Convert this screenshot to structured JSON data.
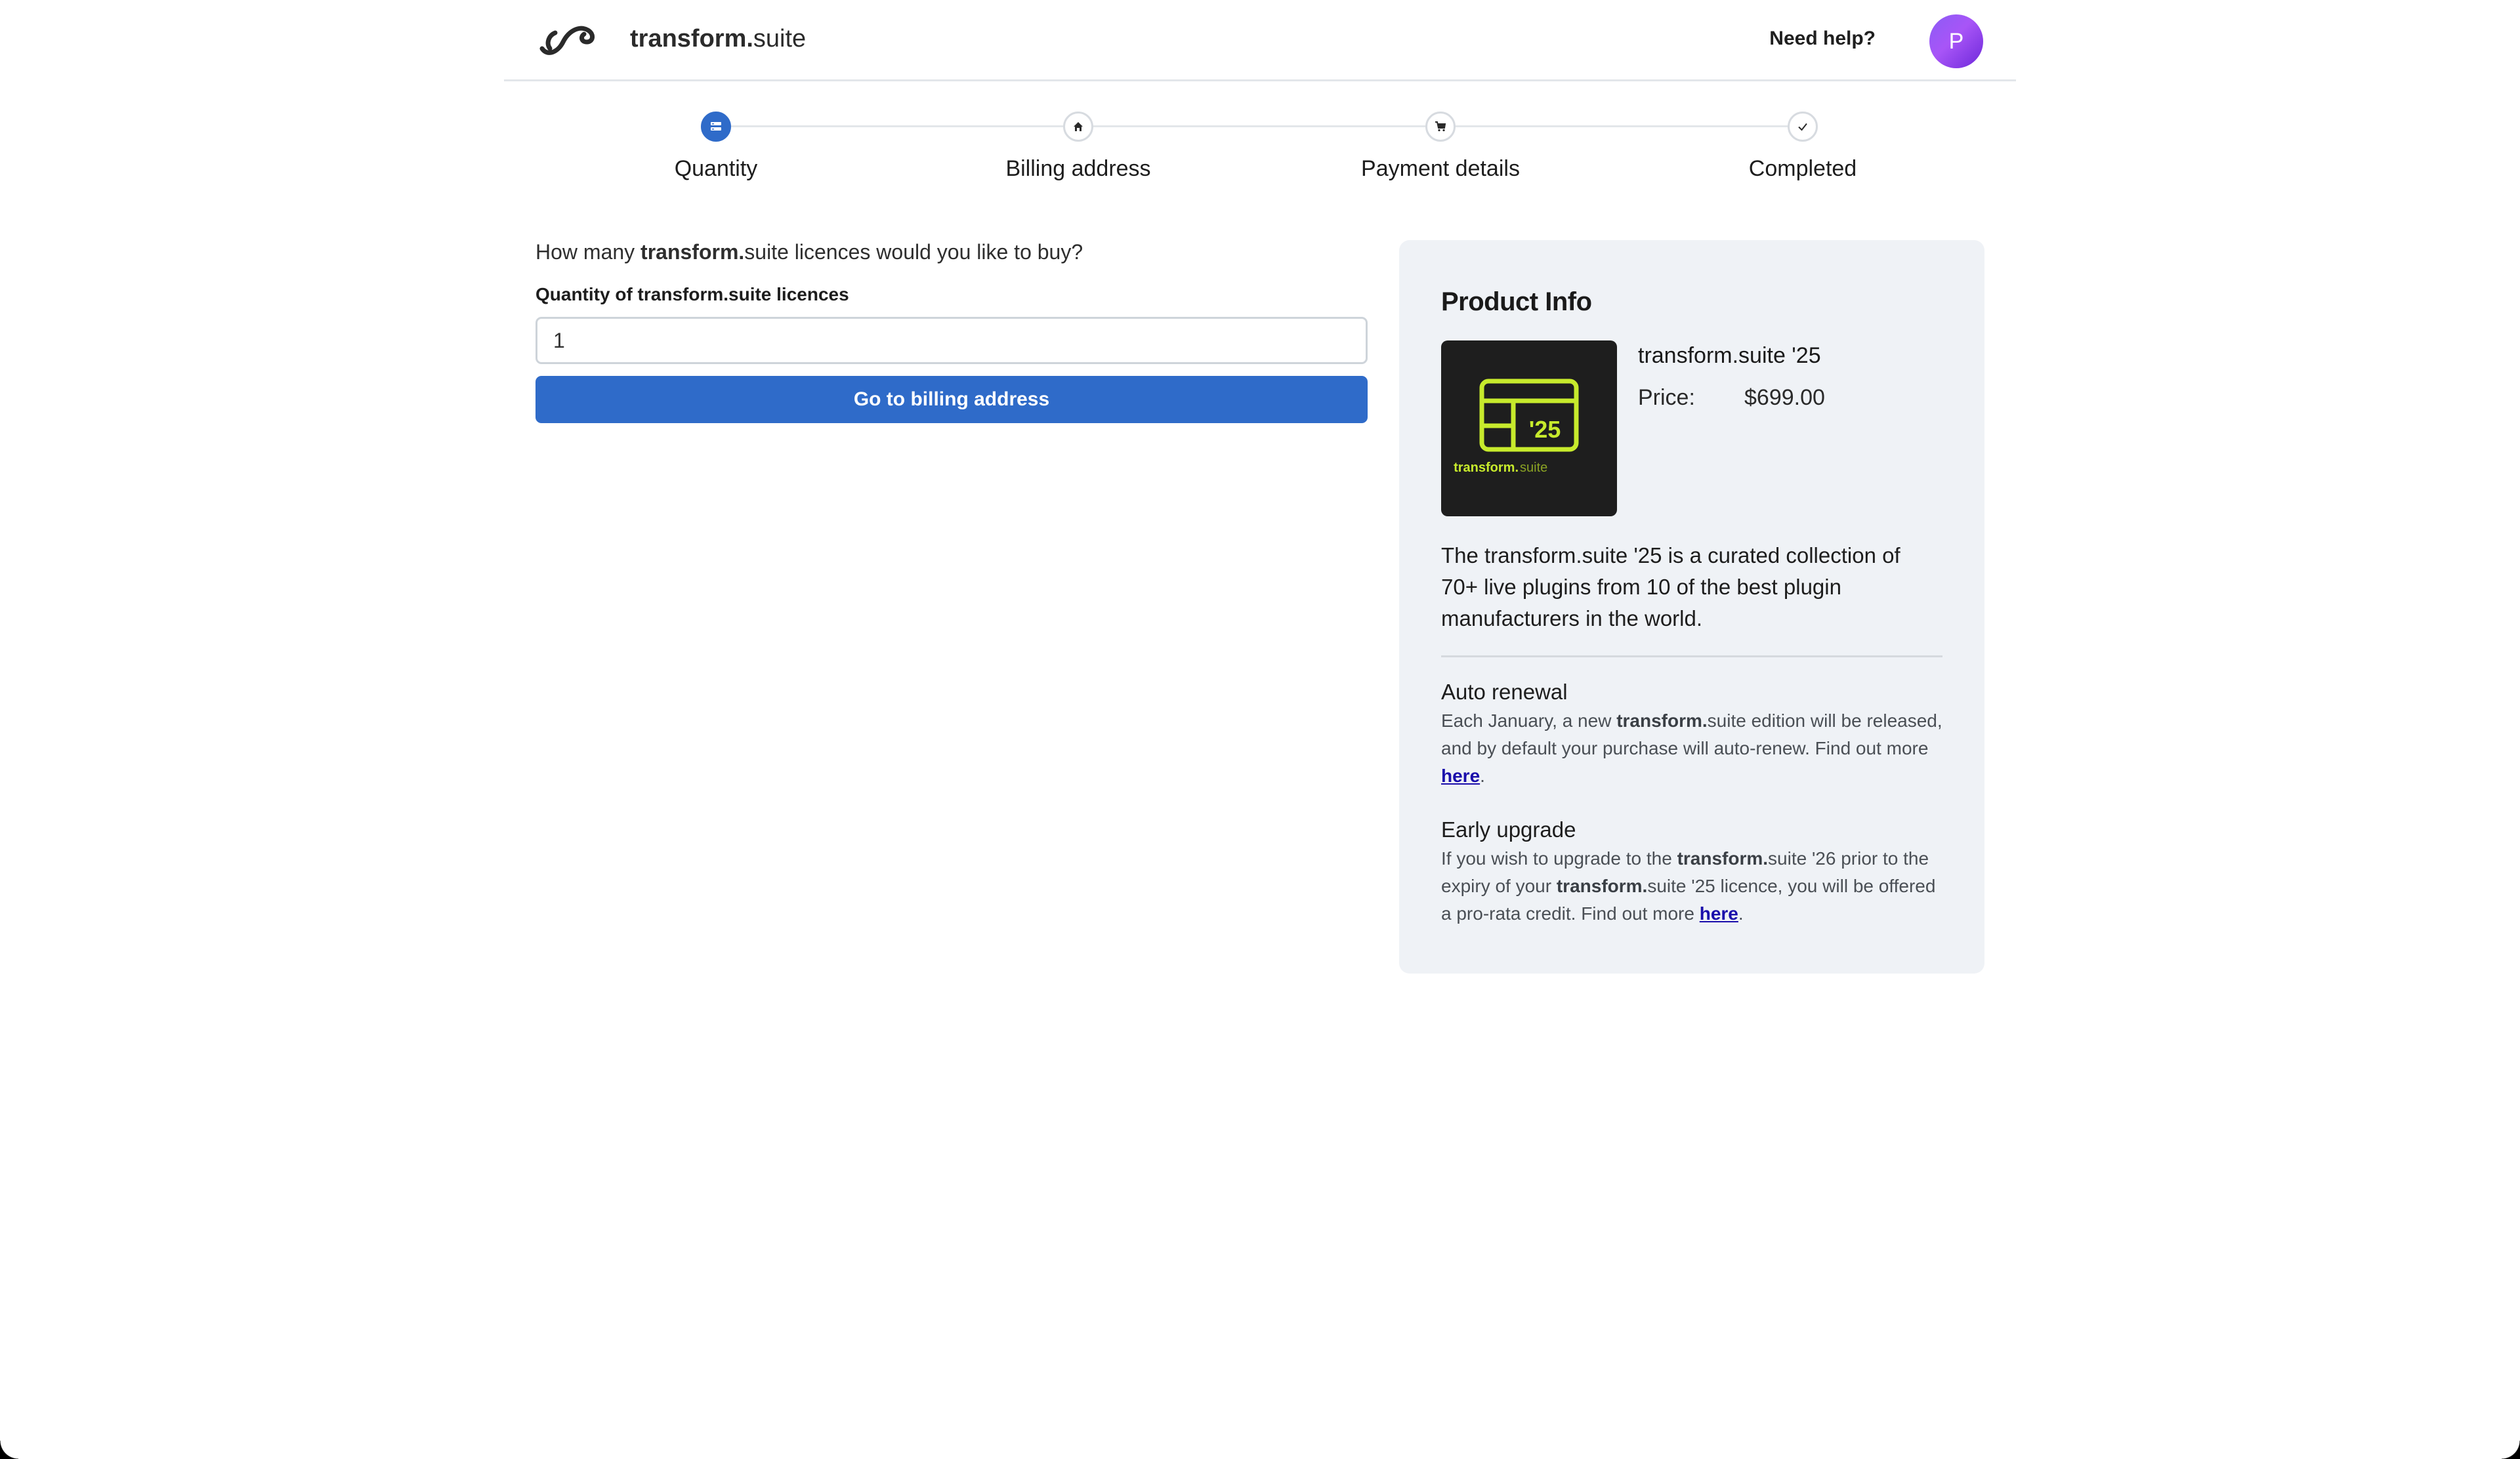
{
  "header": {
    "brand_bold": "transform.",
    "brand_rest": "suite",
    "help_label": "Need help?",
    "avatar_initial": "P"
  },
  "stepper": {
    "steps": [
      {
        "label": "Quantity",
        "icon": "list-icon",
        "state": "active"
      },
      {
        "label": "Billing address",
        "icon": "home-icon",
        "state": "pending"
      },
      {
        "label": "Payment details",
        "icon": "cart-icon",
        "state": "pending"
      },
      {
        "label": "Completed",
        "icon": "check-icon",
        "state": "pending"
      }
    ]
  },
  "form": {
    "question_pre": "How many ",
    "question_bold": "transform.",
    "question_post": "suite licences would you like to buy?",
    "field_label_pre": "Quantity of ",
    "field_label_bold": "transform.",
    "field_label_post": "suite licences",
    "quantity_value": "1",
    "submit_label": "Go to billing address"
  },
  "product": {
    "card_title": "Product Info",
    "name": "transform.suite '25",
    "price_label": "Price:",
    "price_value": "$699.00",
    "image_year": "'25",
    "image_brand_bold": "transform.",
    "image_brand_rest": "suite",
    "description": "The transform.suite '25 is a curated collection of 70+ live plugins from 10 of the best plugin manufacturers in the world.",
    "auto_renewal": {
      "title": "Auto renewal",
      "text_1": "Each January, a new ",
      "text_bold": "transform.",
      "text_2": "suite edition will be released, and by default your purchase will auto-renew. Find out more ",
      "link": "here",
      "text_end": "."
    },
    "early_upgrade": {
      "title": "Early upgrade",
      "text_1": "If you wish to upgrade to the ",
      "text_bold_1": "transform.",
      "text_2": "suite '26 prior to the expiry of your ",
      "text_bold_2": "transform.",
      "text_3": "suite '25 licence, you will be offered a pro-rata credit. Find out more ",
      "link": "here",
      "text_end": "."
    }
  },
  "colors": {
    "primary": "#2f6bc9",
    "card_bg": "#eff2f6",
    "avatar": "#8b5cf6",
    "product_accent": "#c7ea2c"
  }
}
